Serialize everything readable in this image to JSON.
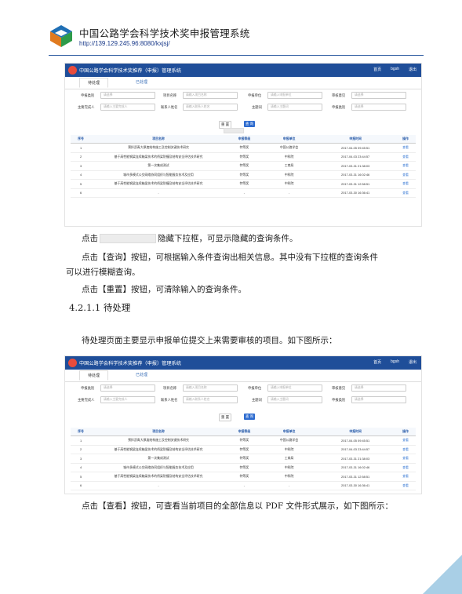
{
  "header": {
    "title": "中国公路学会科学技术奖申报管理系统",
    "url": "http://139.129.245.96:8080/kxjsj/"
  },
  "screen": {
    "app_title": "中国公路学会科学技术奖推荐（申报）管理系统",
    "nav": [
      "首页",
      "bgsh",
      "退出"
    ],
    "tabs": [
      "待处理",
      "已处理"
    ],
    "form": {
      "labels": [
        "申报类别",
        "项目名称",
        "申报单位",
        "审核意见",
        "主要完成人",
        "联系人姓名",
        "主题词",
        "申报类别"
      ],
      "placeholders": [
        "请选择",
        "请输入项目名称",
        "请输入申报单位",
        "请选择",
        "请输入主要完成人",
        "请输入联系人姓名",
        "请输入主题词",
        "请选择"
      ]
    },
    "buttons": {
      "reset": "重 置",
      "query": "查 询"
    },
    "table": {
      "headers": [
        "序号",
        "项目名称",
        "申报等级",
        "申报单位",
        "申报时间",
        "操作"
      ],
      "rows": [
        [
          "1",
          "预拌沥青大厚度结构施工及控制关键技术研究",
          "特等奖",
          "中国公路学会",
          "2017-04-05 09:45:51",
          "查看"
        ],
        [
          "2",
          "基于高性能钢梁连续箱梁技术的桥梁防撞及结构安全评估技术研究",
          "特等奖",
          "中科院",
          "2017-04-03 23:44:57",
          "查看"
        ],
        [
          "3",
          "第一次集成测试",
          "特等奖",
          "工商局",
          "2017-03-31 21:38:03",
          "查看"
        ],
        [
          "4",
          "城市多模式公交网络协同组织与智能服务技术及应用",
          "特等奖",
          "中科院",
          "2017-03-31 16:02:46",
          "查看"
        ],
        [
          "5",
          "基于高性能钢梁连续箱梁技术的桥梁防撞及结构安全评估技术研究",
          "特等奖",
          "中科院",
          "2017-03-31 12:58:51",
          "查看"
        ],
        [
          "6",
          "-",
          "-",
          "-",
          "2017-03-30 16:36:41",
          "查看"
        ]
      ]
    }
  },
  "text": {
    "p1_a": "点击",
    "p1_b": "隐藏下拉框，可显示隐藏的查询条件。",
    "p2": "点击【查询】按钮，可根据输入条件查询出相关信息。其中没有下拉框的查询条件",
    "p2b": "可以进行模糊查询。",
    "p3": "点击【重置】按钮，可清除输入的查询条件。",
    "section": "4.2.1.1  待处理",
    "p4": "待处理页面主要显示申报单位提交上来需要审核的项目。如下图所示：",
    "p5": "点击【查看】按钮，可查看当前项目的全部信息以 PDF 文件形式展示，如下图所示："
  },
  "colors": {
    "brand": "#1f4e99",
    "accent": "#2d6bcf",
    "link": "#3a7bd5"
  }
}
